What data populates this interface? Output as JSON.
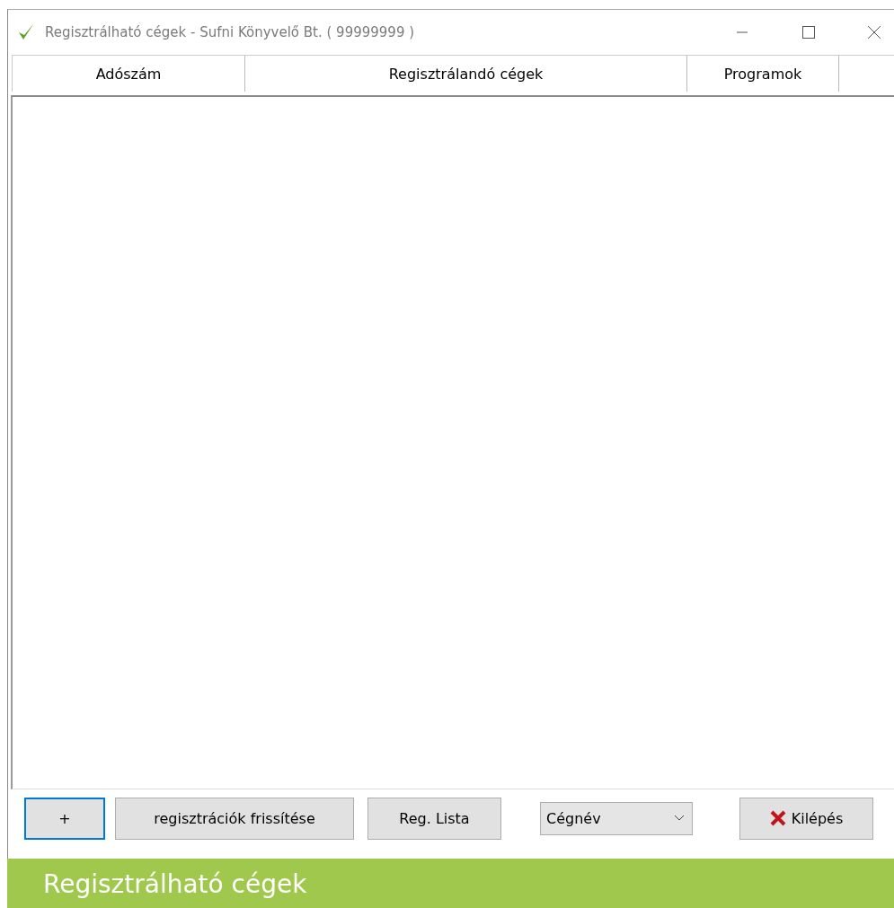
{
  "window": {
    "title": "Regisztrálható cégek - Sufni Könyvelő Bt. ( 99999999 )"
  },
  "table": {
    "columns": [
      "Adószám",
      "Regisztrálandó cégek",
      "Programok"
    ]
  },
  "toolbar": [
    {
      "kind": "button",
      "label": "+",
      "focused": true
    },
    {
      "kind": "button",
      "label": "regisztrációk frissítése",
      "focused": false
    },
    {
      "kind": "button",
      "label": "Reg. Lista",
      "focused": false
    },
    {
      "kind": "dropdown",
      "value": "Cégnév"
    },
    {
      "kind": "exit-button",
      "label": "Kilépés",
      "focused": false
    }
  ],
  "banner": {
    "text": "Regisztrálható cégek"
  }
}
